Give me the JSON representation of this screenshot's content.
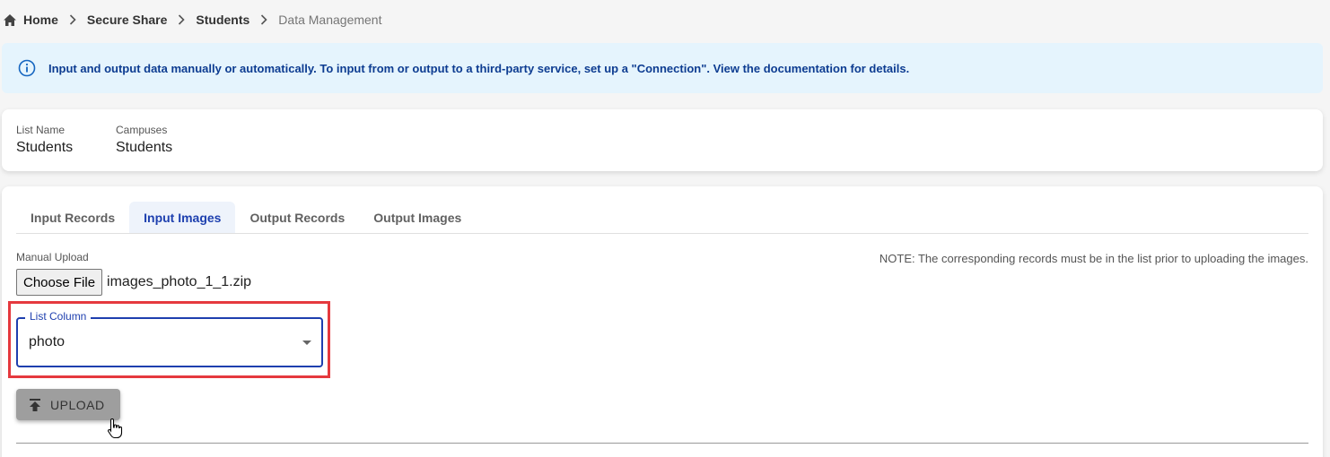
{
  "breadcrumb": {
    "items": [
      "Home",
      "Secure Share",
      "Students"
    ],
    "current": "Data Management"
  },
  "alert": {
    "icon": "info-icon",
    "text": "Input and output data manually or automatically. To input from or output to a third-party service, set up a \"Connection\". View the documentation for details."
  },
  "info": {
    "list_name_label": "List Name",
    "list_name_value": "Students",
    "campuses_label": "Campuses",
    "campuses_value": "Students"
  },
  "tabs": [
    {
      "label": "Input Records",
      "active": false
    },
    {
      "label": "Input Images",
      "active": true
    },
    {
      "label": "Output Records",
      "active": false
    },
    {
      "label": "Output Images",
      "active": false
    }
  ],
  "upload": {
    "section_label": "Manual Upload",
    "choose_file_label": "Choose File",
    "file_name": "images_photo_1_1.zip",
    "note": "NOTE: The corresponding records must be in the list prior to uploading the images.",
    "list_column_label": "List Column",
    "list_column_value": "photo",
    "upload_button_label": "UPLOAD"
  },
  "colors": {
    "accent": "#1e40af",
    "alert_bg": "#e5f4fd",
    "highlight": "#e5393e",
    "button_bg": "#9e9e9e"
  }
}
